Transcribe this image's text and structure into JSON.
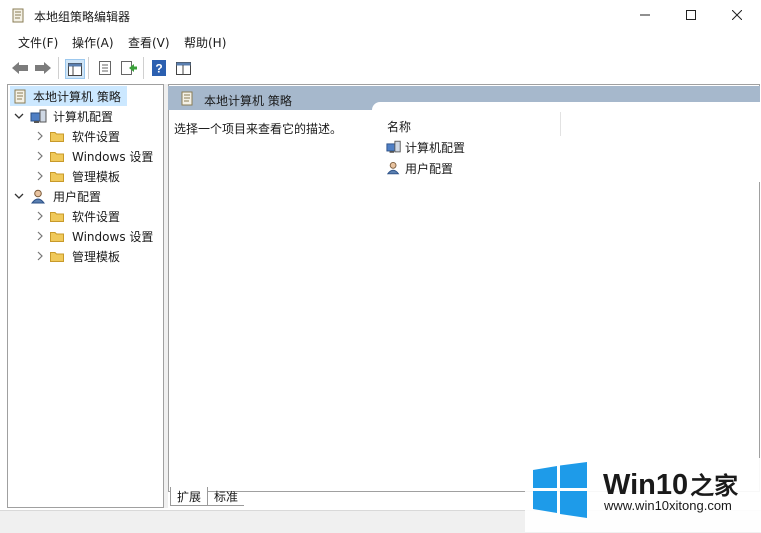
{
  "window": {
    "title": "本地组策略编辑器",
    "controls": {
      "minimize": "minimize-icon",
      "maximize": "maximize-icon",
      "close": "close-icon"
    }
  },
  "menu": {
    "items": [
      {
        "label": "文件(F)"
      },
      {
        "label": "操作(A)"
      },
      {
        "label": "查看(V)"
      },
      {
        "label": "帮助(H)"
      }
    ]
  },
  "toolbar": {
    "icons": [
      "back-arrow-icon",
      "forward-arrow-icon",
      "show-hide-tree-icon",
      "properties-icon",
      "export-list-icon",
      "help-icon",
      "extended-view-icon"
    ]
  },
  "tree": {
    "root": "本地计算机 策略",
    "computer": {
      "label": "计算机配置",
      "children": [
        "软件设置",
        "Windows 设置",
        "管理模板"
      ]
    },
    "user": {
      "label": "用户配置",
      "children": [
        "软件设置",
        "Windows 设置",
        "管理模板"
      ]
    }
  },
  "details": {
    "header": "本地计算机 策略",
    "description": "选择一个项目来查看它的描述。",
    "column_name": "名称",
    "items": [
      "计算机配置",
      "用户配置"
    ]
  },
  "tabs": {
    "expand": "扩展",
    "standard": "标准"
  },
  "watermark": {
    "brand_part1": "Win10",
    "brand_part2": "之家",
    "url": "www.win10xitong.com",
    "colors": {
      "logo_blue": "#1e9be9"
    }
  },
  "colors": {
    "header_band": "#a6b8cc",
    "folder": "#f0c95a"
  }
}
